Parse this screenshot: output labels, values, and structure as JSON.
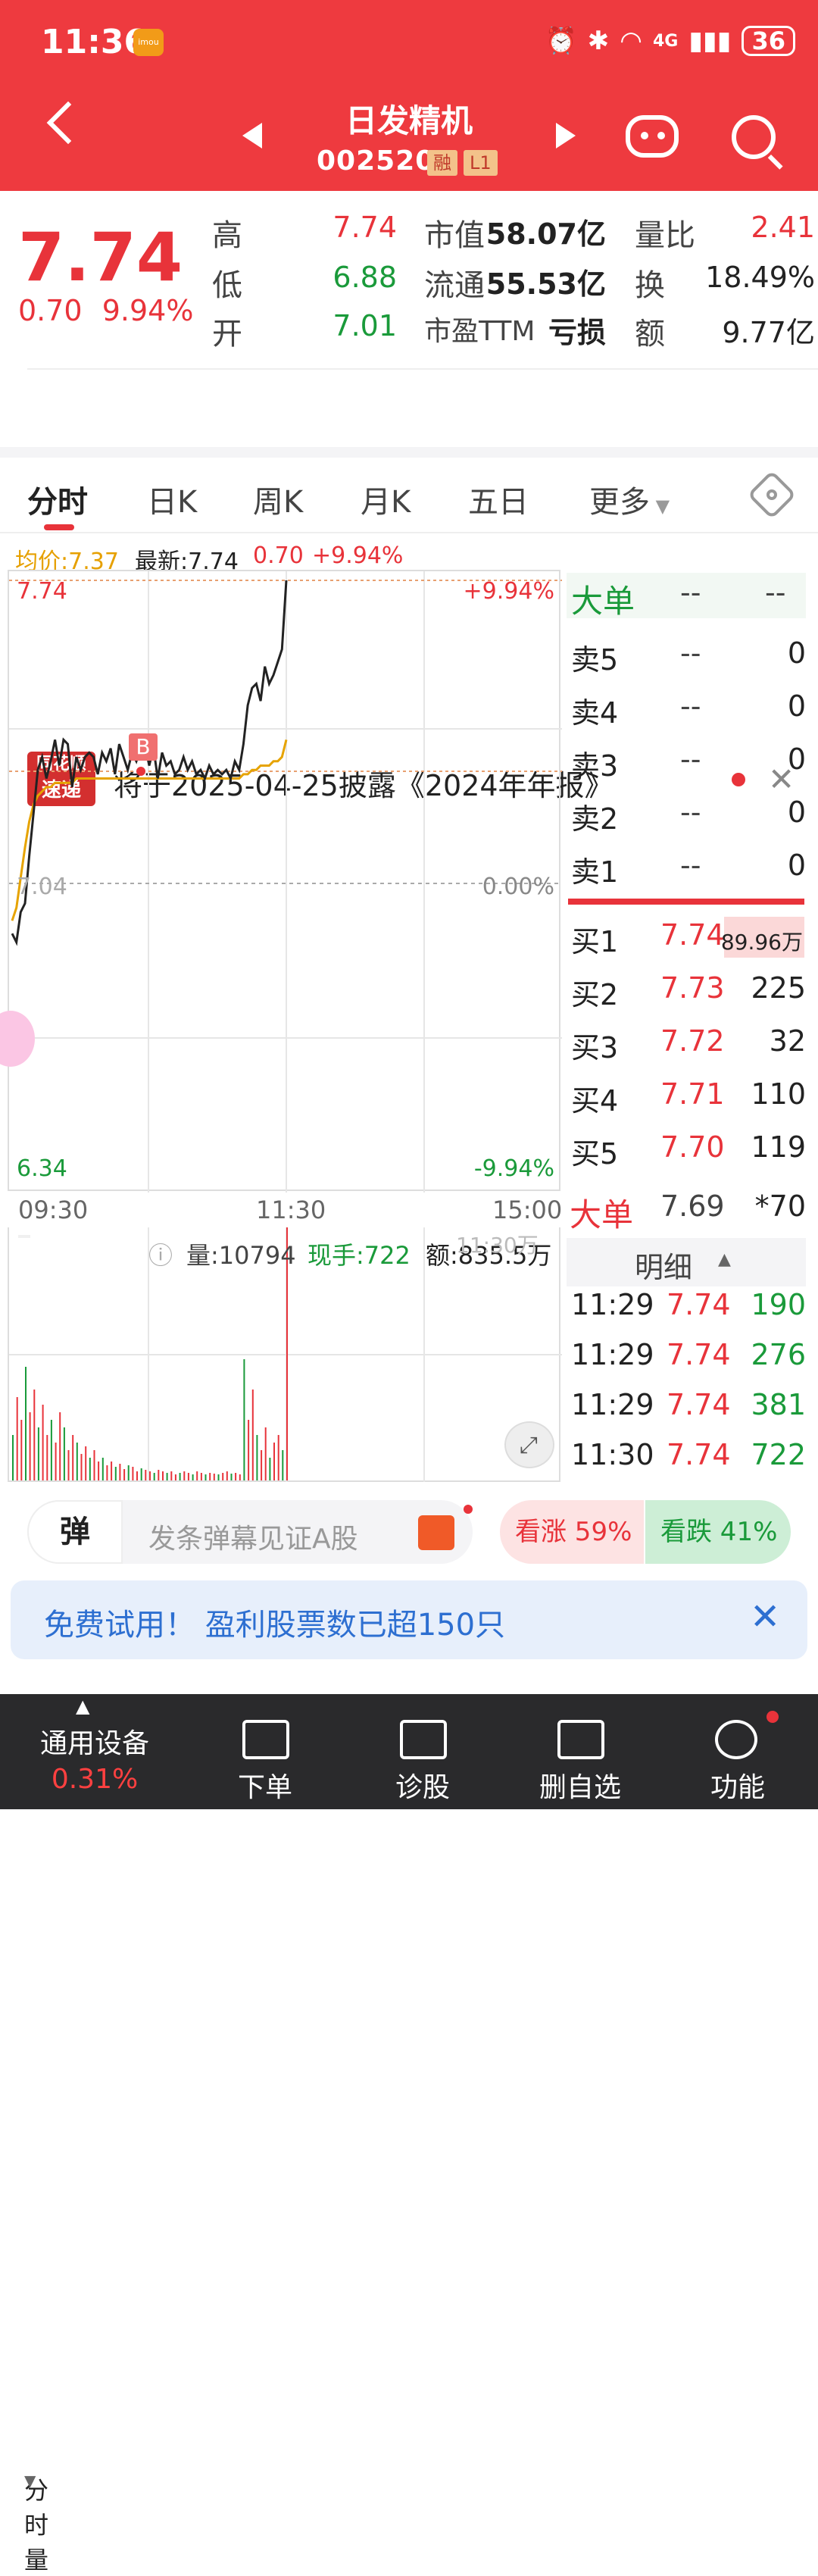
{
  "status_bar": {
    "time": "11:36",
    "imou_label": "imou",
    "network": "4G",
    "battery": "36"
  },
  "header": {
    "stock_name": "日发精机",
    "stock_code": "002520",
    "badge_margin": "融",
    "badge_level": "L1"
  },
  "quote": {
    "price": "7.74",
    "change": "0.70",
    "change_pct": "9.94%",
    "high_label": "高",
    "high": "7.74",
    "low_label": "低",
    "low": "6.88",
    "open_label": "开",
    "open": "7.01",
    "mktcap_label": "市值",
    "mktcap": "58.07亿",
    "float_label": "流通",
    "float": "55.53亿",
    "pe_label": "市盈TTM",
    "pe": "亏损",
    "vol_ratio_label": "量比",
    "vol_ratio": "2.41",
    "turnover_label": "换",
    "turnover": "18.49%",
    "amount_label": "额",
    "amount": "9.77亿"
  },
  "notice": {
    "logo_top": "同花顺",
    "logo_bottom": "速递",
    "text": "将于2025-04-25披露《2024年年报》"
  },
  "tabs": [
    "分时",
    "日K",
    "周K",
    "月K",
    "五日",
    "更多"
  ],
  "avg_bar": {
    "avg_label": "均价:7.37",
    "latest_label": "最新:7.74",
    "change": "0.70",
    "pct": "+9.94%"
  },
  "chart_data": {
    "type": "line",
    "y_top": "7.74",
    "y_mid": "7.04",
    "y_bottom": "6.34",
    "pct_top": "+9.94%",
    "pct_mid": "0.00%",
    "pct_bottom": "-9.94%",
    "x_labels": [
      "09:30",
      "11:30",
      "15:00"
    ],
    "ylim": [
      6.34,
      7.74
    ],
    "price_series": [
      6.92,
      6.9,
      6.97,
      6.99,
      7.1,
      7.2,
      7.3,
      7.33,
      7.28,
      7.32,
      7.37,
      7.31,
      7.37,
      7.36,
      7.26,
      7.33,
      7.3,
      7.33,
      7.34,
      7.33,
      7.29,
      7.34,
      7.32,
      7.35,
      7.29,
      7.36,
      7.33,
      7.3,
      7.34,
      7.32,
      7.35,
      7.36,
      7.31,
      7.35,
      7.28,
      7.34,
      7.31,
      7.32,
      7.29,
      7.3,
      7.33,
      7.3,
      7.32,
      7.29,
      7.3,
      7.28,
      7.31,
      7.29,
      7.3,
      7.29,
      7.3,
      7.28,
      7.32,
      7.3,
      7.36,
      7.45,
      7.49,
      7.5,
      7.46,
      7.54,
      7.5,
      7.52,
      7.55,
      7.58,
      7.74
    ],
    "avg_series": [
      6.95,
      6.98,
      7.05,
      7.12,
      7.18,
      7.22,
      7.24,
      7.25,
      7.26,
      7.26,
      7.27,
      7.27,
      7.27,
      7.27,
      7.27,
      7.28,
      7.28,
      7.28,
      7.28,
      7.28,
      7.28,
      7.28,
      7.28,
      7.28,
      7.28,
      7.28,
      7.28,
      7.28,
      7.28,
      7.28,
      7.28,
      7.28,
      7.28,
      7.28,
      7.28,
      7.28,
      7.28,
      7.28,
      7.28,
      7.28,
      7.28,
      7.28,
      7.28,
      7.28,
      7.28,
      7.28,
      7.28,
      7.28,
      7.28,
      7.28,
      7.28,
      7.28,
      7.28,
      7.28,
      7.29,
      7.29,
      7.3,
      7.3,
      7.31,
      7.31,
      7.31,
      7.32,
      7.32,
      7.33,
      7.37
    ],
    "marker": "B"
  },
  "order_book": {
    "big_order_label": "大单",
    "big_order_v1": "--",
    "big_order_v2": "--",
    "asks": [
      {
        "label": "卖5",
        "price": "--",
        "vol": "0"
      },
      {
        "label": "卖4",
        "price": "--",
        "vol": "0"
      },
      {
        "label": "卖3",
        "price": "--",
        "vol": "0"
      },
      {
        "label": "卖2",
        "price": "--",
        "vol": "0"
      },
      {
        "label": "卖1",
        "price": "--",
        "vol": "0"
      }
    ],
    "bids": [
      {
        "label": "买1",
        "price": "7.74",
        "vol": "89.96万"
      },
      {
        "label": "买2",
        "price": "7.73",
        "vol": "225"
      },
      {
        "label": "买3",
        "price": "7.72",
        "vol": "32"
      },
      {
        "label": "买4",
        "price": "7.71",
        "vol": "110"
      },
      {
        "label": "买5",
        "price": "7.70",
        "vol": "119"
      }
    ],
    "big_order2_label": "大单",
    "big_order2_price": "7.69",
    "big_order2_vol": "*70"
  },
  "detail": {
    "header": "明细",
    "rows": [
      {
        "time": "11:29",
        "price": "7.74",
        "vol": "190"
      },
      {
        "time": "11:29",
        "price": "7.74",
        "vol": "276"
      },
      {
        "time": "11:29",
        "price": "7.74",
        "vol": "381"
      },
      {
        "time": "11:30",
        "price": "7.74",
        "vol": "722"
      }
    ]
  },
  "volume": {
    "selector": "分时量",
    "vol_label": "量:10794",
    "hand_label": "现手:722",
    "amount_label": "额:835.5万",
    "time_overlay": "11:30万"
  },
  "danmu": {
    "button": "弹",
    "placeholder": "发条弹幕见证A股",
    "up_label": "看涨 59%",
    "down_label": "看跌 41%"
  },
  "banner": {
    "text": "免费试用！ 盈利股票数已超150只"
  },
  "bottom_nav": [
    {
      "label": "通用设备",
      "sub": "0.31%"
    },
    {
      "label": "下单"
    },
    {
      "label": "诊股"
    },
    {
      "label": "删自选"
    },
    {
      "label": "功能"
    }
  ]
}
